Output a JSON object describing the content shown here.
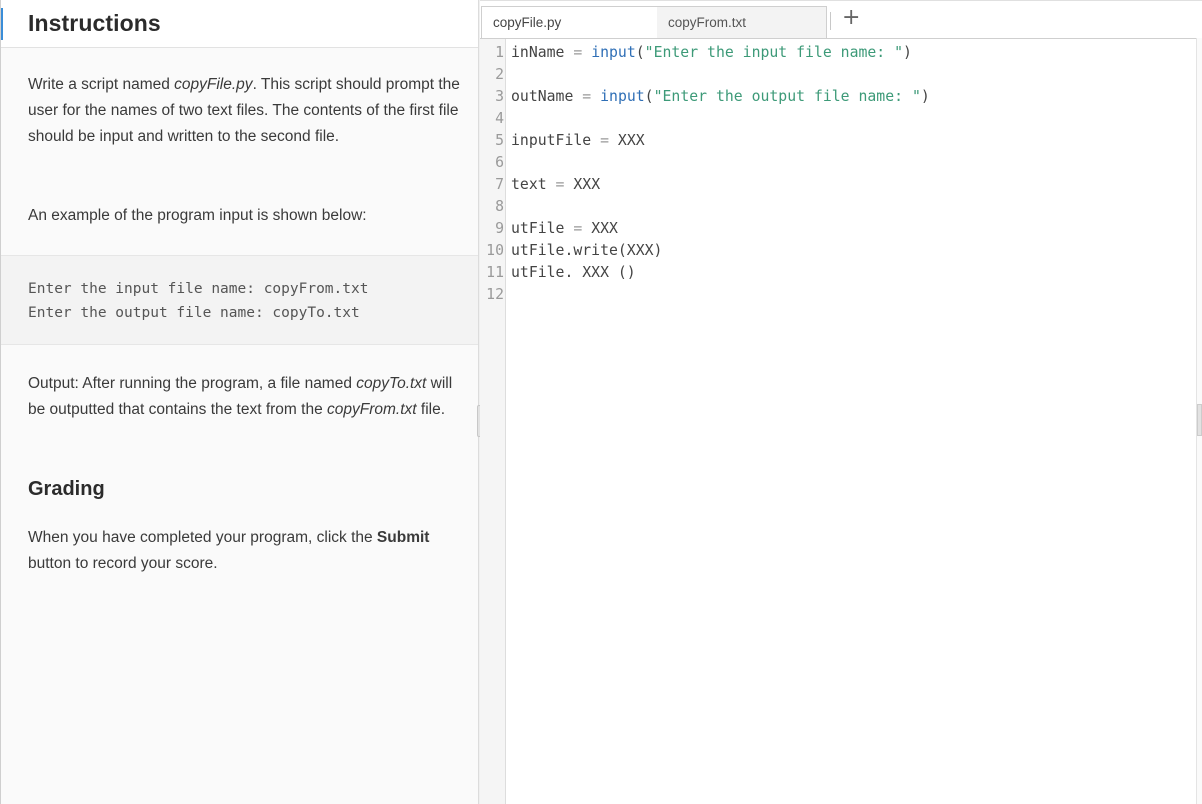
{
  "instructions": {
    "title": "Instructions",
    "p1": {
      "prefix": "Write a script named ",
      "file": "copyFile.py",
      "suffix": ". This script should prompt the user for the names of two text files. The contents of the first file should be input and written to the second file."
    },
    "p2": "An example of the program input is shown below:",
    "example_lines": [
      "Enter the input file name: copyFrom.txt",
      "Enter the output file name: copyTo.txt"
    ],
    "p3": {
      "prefix": "Output: After running the program, a file named ",
      "file1": "copyTo.txt",
      "middle": " will be outputted that contains the text from the ",
      "file2": "copyFrom.txt",
      "suffix": " file."
    },
    "grading_title": "Grading",
    "p4": {
      "prefix": "When you have completed your program, click the ",
      "bold": "Submit",
      "suffix": " button to record your score."
    }
  },
  "editor": {
    "tabs": [
      {
        "label": "copyFile.py",
        "active": true
      },
      {
        "label": "copyFrom.txt",
        "active": false
      }
    ],
    "add_tab_symbol": "+",
    "lines": [
      {
        "num": "1",
        "tokens": [
          {
            "t": "inName ",
            "k": "var"
          },
          {
            "t": "=",
            "k": "op"
          },
          {
            "t": " ",
            "k": "var"
          },
          {
            "t": "input",
            "k": "fn"
          },
          {
            "t": "(",
            "k": "var"
          },
          {
            "t": "\"Enter the input file name: \"",
            "k": "str"
          },
          {
            "t": ")",
            "k": "var"
          }
        ]
      },
      {
        "num": "2",
        "tokens": []
      },
      {
        "num": "3",
        "tokens": [
          {
            "t": "outName ",
            "k": "var"
          },
          {
            "t": "=",
            "k": "op"
          },
          {
            "t": " ",
            "k": "var"
          },
          {
            "t": "input",
            "k": "fn"
          },
          {
            "t": "(",
            "k": "var"
          },
          {
            "t": "\"Enter the output file name: \"",
            "k": "str"
          },
          {
            "t": ")",
            "k": "var"
          }
        ]
      },
      {
        "num": "4",
        "tokens": []
      },
      {
        "num": "5",
        "tokens": [
          {
            "t": "inputFile ",
            "k": "var"
          },
          {
            "t": "=",
            "k": "op"
          },
          {
            "t": " XXX",
            "k": "var"
          }
        ]
      },
      {
        "num": "6",
        "tokens": []
      },
      {
        "num": "7",
        "tokens": [
          {
            "t": "text ",
            "k": "var"
          },
          {
            "t": "=",
            "k": "op"
          },
          {
            "t": " XXX",
            "k": "var"
          }
        ]
      },
      {
        "num": "8",
        "tokens": []
      },
      {
        "num": "9",
        "tokens": [
          {
            "t": "utFile ",
            "k": "var"
          },
          {
            "t": "=",
            "k": "op"
          },
          {
            "t": " XXX",
            "k": "var"
          }
        ]
      },
      {
        "num": "10",
        "tokens": [
          {
            "t": "utFile.write(XXX)",
            "k": "var"
          }
        ]
      },
      {
        "num": "11",
        "tokens": [
          {
            "t": "utFile. XXX ()",
            "k": "var"
          }
        ]
      },
      {
        "num": "12",
        "tokens": []
      }
    ]
  }
}
